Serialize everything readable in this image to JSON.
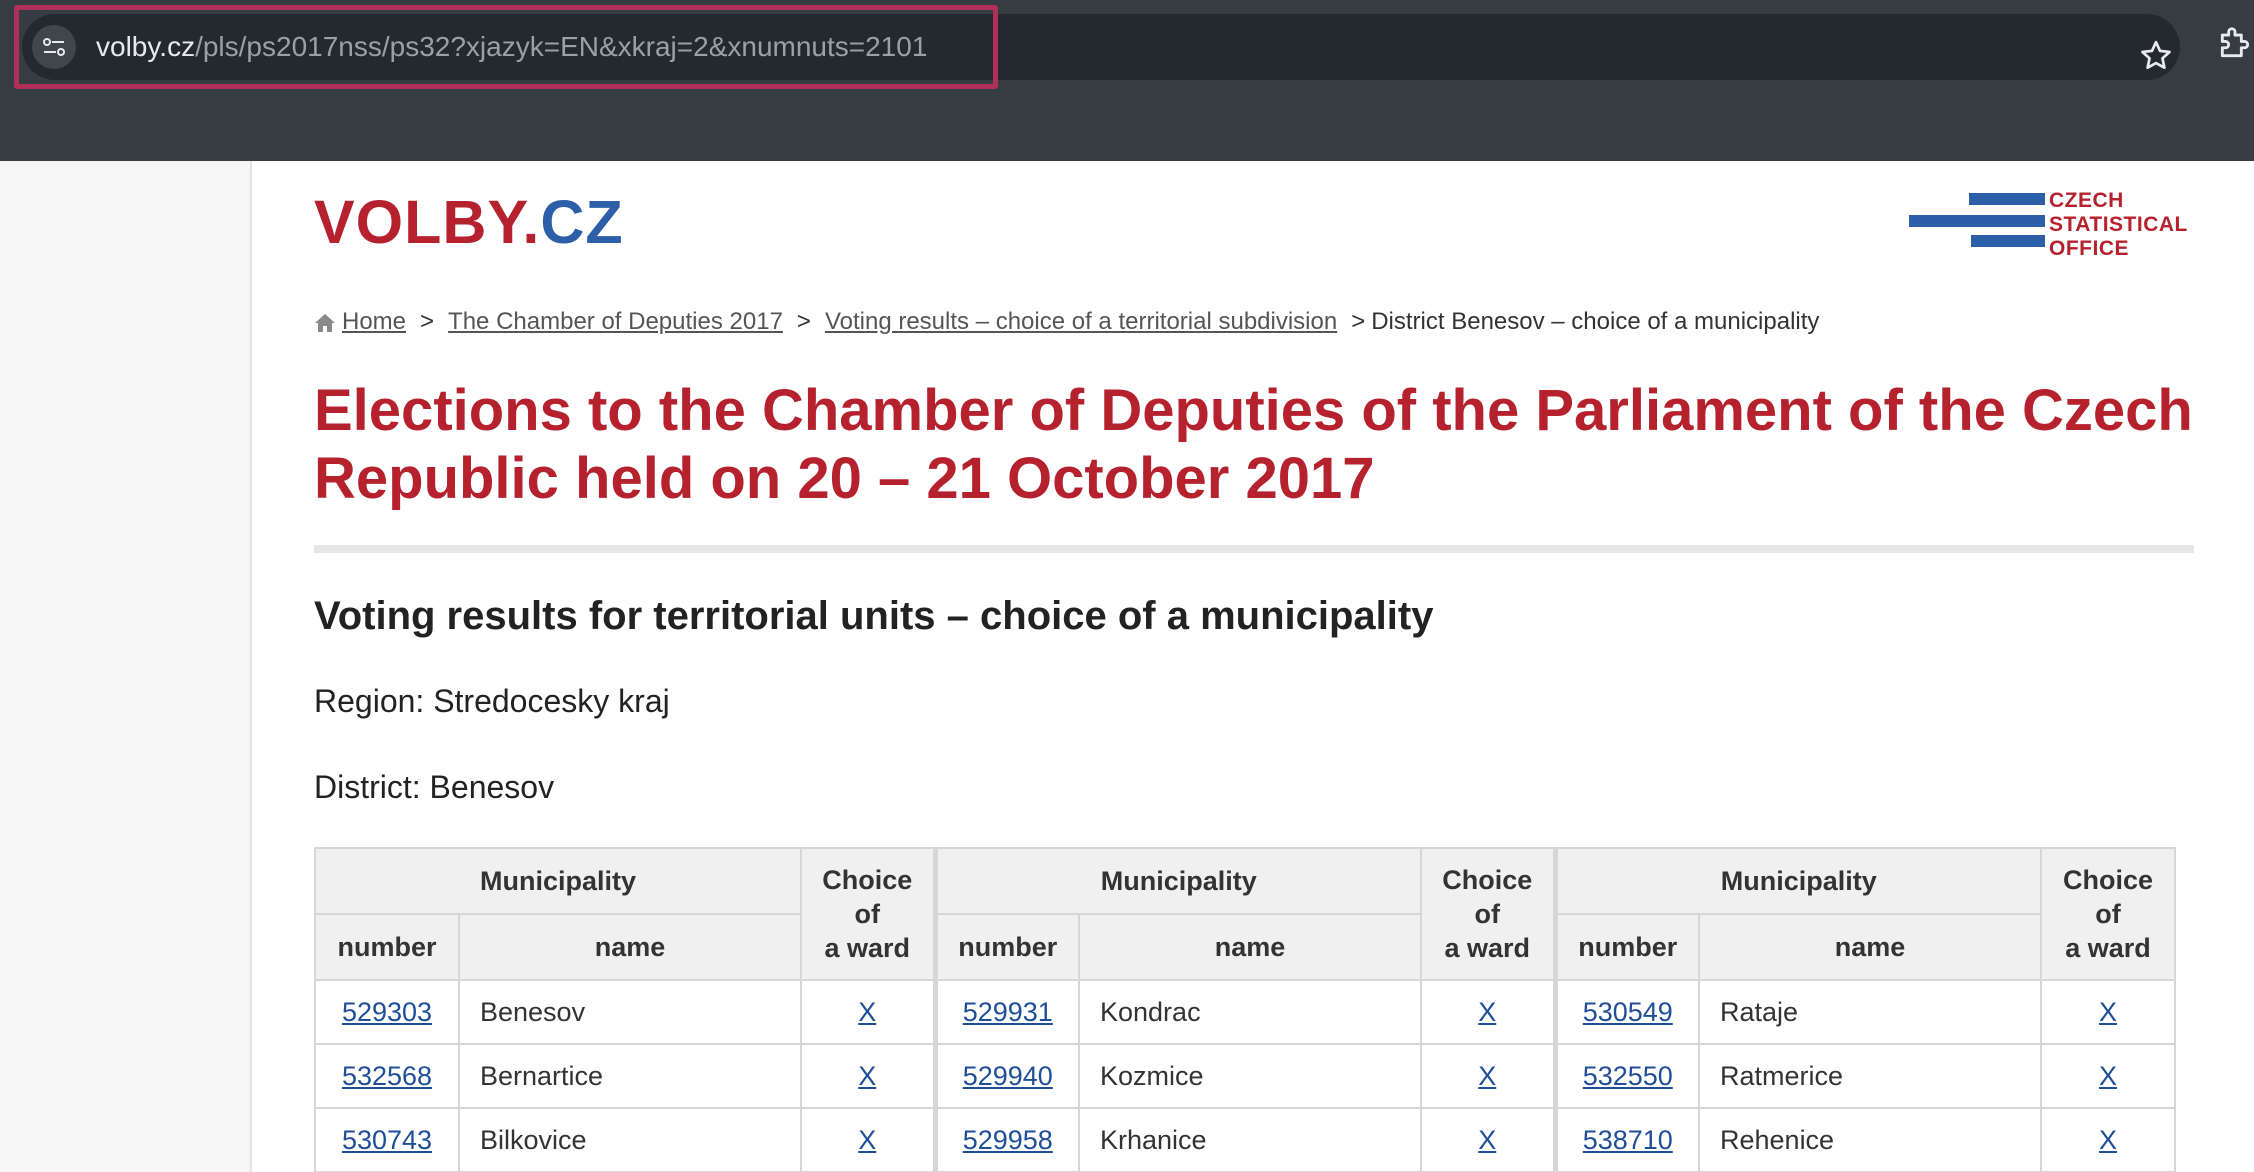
{
  "browser": {
    "url_host": "volby.cz",
    "url_path": "/pls/ps2017nss/ps32?xjazyk=EN&xkraj=2&xnumnuts=2101"
  },
  "site": {
    "logo_part1": "VOLBY.",
    "logo_part2": "CZ",
    "cso_lines": [
      "CZECH",
      "STATISTICAL",
      "OFFICE"
    ]
  },
  "breadcrumb": {
    "home": "Home",
    "item1": "The Chamber of Deputies 2017",
    "item2": "Voting results – choice of a territorial subdivision",
    "current": "District Benesov – choice of a municipality",
    "separator": ">"
  },
  "page": {
    "title": "Elections to the Chamber of Deputies of the Parliament of the Czech Republic held on 20 – 21 October 2017",
    "subtitle": "Voting results for territorial units – choice of a municipality",
    "region": "Region: Stredocesky kraj",
    "district": "District: Benesov"
  },
  "table": {
    "group_header": "Municipality",
    "col_number": "number",
    "col_name": "name",
    "choice_line1": "Choice",
    "choice_line2": "of",
    "choice_line3": "a ward",
    "rows": [
      [
        {
          "number": "529303",
          "name": "Benesov",
          "ward": "X"
        },
        {
          "number": "529931",
          "name": "Kondrac",
          "ward": "X"
        },
        {
          "number": "530549",
          "name": "Rataje",
          "ward": "X"
        }
      ],
      [
        {
          "number": "532568",
          "name": "Bernartice",
          "ward": "X"
        },
        {
          "number": "529940",
          "name": "Kozmice",
          "ward": "X"
        },
        {
          "number": "532550",
          "name": "Ratmerice",
          "ward": "X"
        }
      ],
      [
        {
          "number": "530743",
          "name": "Bilkovice",
          "ward": "X"
        },
        {
          "number": "529958",
          "name": "Krhanice",
          "ward": "X"
        },
        {
          "number": "538710",
          "name": "Rehenice",
          "ward": "X"
        }
      ]
    ]
  }
}
